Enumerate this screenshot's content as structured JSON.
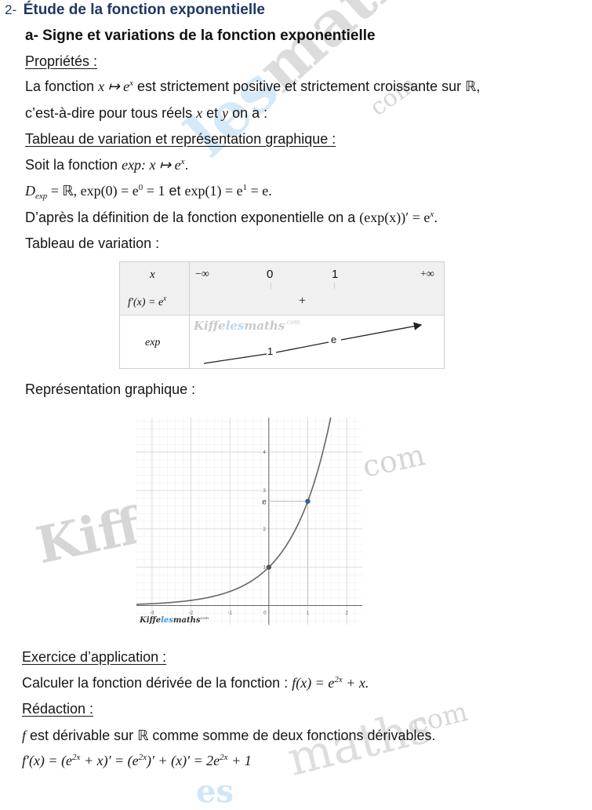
{
  "section": {
    "number": "2-",
    "title": "Étude de la fonction exponentielle"
  },
  "subsection": {
    "title": "a- Signe et variations de la fonction exponentielle"
  },
  "properties": {
    "heading": "Propriétés :",
    "line1_pre": "La fonction ",
    "line1_math": "x ↦ e",
    "line1_sup": "x",
    "line1_post": " est strictement positive et strictement croissante sur ℝ,",
    "line2_pre": "c’est-à-dire pour tous réels  ",
    "line2_x": "x",
    "line2_mid": " et ",
    "line2_y": "y",
    "line2_post": " on a :"
  },
  "variation_section": {
    "heading": "Tableau de variation et représentation graphique :",
    "let_pre": "Soit la fonction ",
    "let_math": "exp: x ↦ e",
    "let_sup": "x",
    "let_post": ".",
    "domain_D": "D",
    "domain_sub": "exp",
    "domain_rest1": " = ℝ,  exp(0) = e",
    "domain_sup0": "0",
    "domain_rest2": " = 1",
    "domain_and": "  et ",
    "domain_rest3": "exp(1) = e",
    "domain_sup1": "1",
    "domain_rest4": " = e.",
    "deriv_pre": "D’après la définition de la fonction exponentielle on a ",
    "deriv_math": "(exp(x))′ = e",
    "deriv_sup": "x",
    "deriv_post": ".",
    "table_label": "Tableau de variation :"
  },
  "variation_table": {
    "row_x_label": "x",
    "x_values": [
      "−∞",
      "0",
      "1",
      "+∞"
    ],
    "row_deriv_label": "f′(x) = e",
    "row_deriv_sup": "x",
    "sign": "+",
    "row_f_label": "exp",
    "f_values": [
      "1",
      "e"
    ],
    "watermark": {
      "part1": "Kiffe",
      "part2": "les",
      "part3": "maths",
      "sup": ".com"
    }
  },
  "graph_section": {
    "label": "Représentation graphique :"
  },
  "chart_data": {
    "type": "line",
    "title": "",
    "function": "y = e^x",
    "xlabel": "",
    "ylabel": "",
    "xlim": [
      -3.4,
      2.4
    ],
    "ylim": [
      -0.5,
      4.9
    ],
    "grid": true,
    "x_ticks": [
      "-3",
      "-2",
      "-1",
      "0",
      "1",
      "2"
    ],
    "y_ticks": [
      "1",
      "2",
      "3",
      "4"
    ],
    "y_special_label": "e",
    "points": [
      {
        "x": 0,
        "y": 1,
        "color": "#555555"
      },
      {
        "x": 1,
        "y": 2.718,
        "color": "#3a5f8f"
      }
    ],
    "guides": [
      {
        "x": 1,
        "y": 2.718
      }
    ],
    "watermark": {
      "part1": "Kiffe",
      "part2": "les",
      "part3": "maths",
      "sup": "com"
    }
  },
  "exercise": {
    "heading": "Exercice d’application :",
    "prompt_pre": "Calculer la fonction dérivée de la fonction : ",
    "prompt_math1": "f(x) = e",
    "prompt_sup": "2x",
    "prompt_math2": " + x.",
    "redaction_heading": "Rédaction :",
    "line1_f": "f",
    "line1_text": " est dérivable sur ℝ comme somme de deux fonctions dérivables.",
    "line2": [
      {
        "t": "f′(x) = (e"
      },
      {
        "s": "2x"
      },
      {
        "t": " + x)′ = (e"
      },
      {
        "s": "2x"
      },
      {
        "t": ")′ + (x)′ = 2e"
      },
      {
        "s": "2x"
      },
      {
        "t": " + 1"
      }
    ]
  },
  "watermarks": {
    "diag1": "lesmaths.com",
    "big_kiffe": "Kiffe",
    "com1": "com",
    "com2": "com",
    "maths2": "maths"
  }
}
